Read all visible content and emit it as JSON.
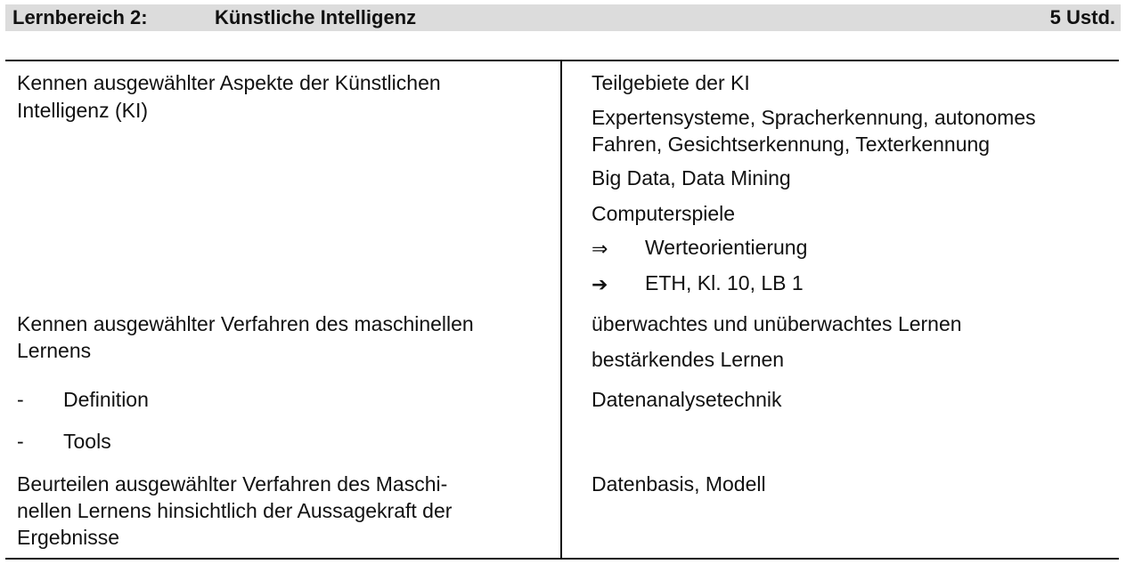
{
  "header": {
    "label": "Lernbereich 2:",
    "title": "Künstliche Intelligenz",
    "hours": "5 Ustd."
  },
  "left": {
    "goal1_line1": "Kennen ausgewählter Aspekte der Künstlichen",
    "goal1_line2": "Intelligenz (KI)",
    "goal2_line1": "Kennen ausgewählter Verfahren des maschinellen",
    "goal2_line2": "Lernens",
    "bullet_marker": "-",
    "bullet1": "Definition",
    "bullet2": "Tools",
    "goal3_line1": "Beurteilen ausgewählter Verfahren des Maschi-",
    "goal3_line2": "nellen Lernens hinsichtlich der Aussagekraft der",
    "goal3_line3": "Ergebnisse"
  },
  "right": {
    "r1": "Teilgebiete der KI",
    "r2_line1": "Expertensysteme, Spracherkennung, autonomes",
    "r2_line2": "Fahren, Gesichtserkennung, Texterkennung",
    "r3": "Big Data, Data Mining",
    "r4": "Computerspiele",
    "value_symbol": "⇒",
    "value_text": "Werteorientierung",
    "ref_symbol": "➔",
    "ref_text": "ETH, Kl. 10, LB 1",
    "r5": "überwachtes und unüberwachtes Lernen",
    "r6": "bestärkendes Lernen",
    "r7": "Datenanalysetechnik",
    "r8": "Datenbasis, Modell"
  }
}
